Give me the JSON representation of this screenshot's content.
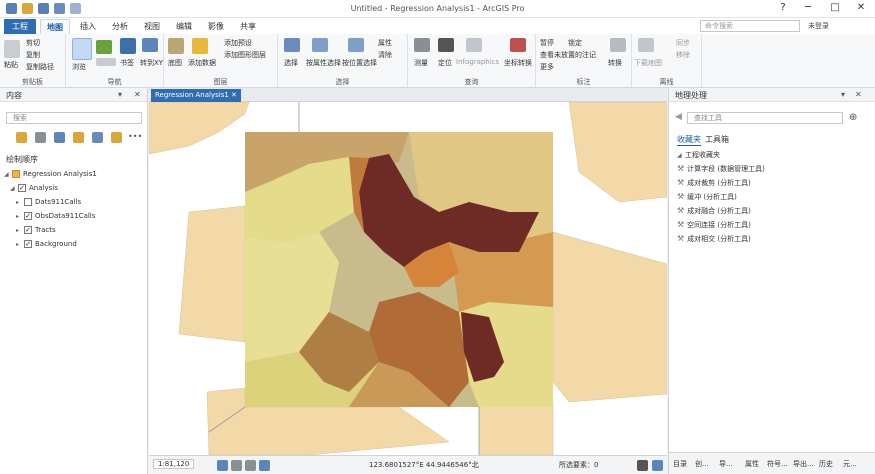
{
  "window": {
    "title": "Untitled - Regression Analysis1 - ArcGIS Pro",
    "minimize": "─",
    "maximize": "□",
    "close": "✕",
    "help": "?",
    "user": "未登录"
  },
  "tabs": [
    {
      "label": "工程"
    },
    {
      "label": "地图"
    },
    {
      "label": "插入"
    },
    {
      "label": "分析"
    },
    {
      "label": "视图"
    },
    {
      "label": "编辑"
    },
    {
      "label": "影像"
    },
    {
      "label": "共享"
    }
  ],
  "search": {
    "placeholder": "命令搜索"
  },
  "ribbon": {
    "clipboard": {
      "label": "剪贴板",
      "paste": "粘贴",
      "cut": "剪切",
      "copy": "复制",
      "copy_path": "复制路径"
    },
    "navigate": {
      "label": "导航",
      "explore": "浏览",
      "bookmarks": "书签",
      "go_to_xy": "转到XY"
    },
    "layer": {
      "label": "图层",
      "basemap": "底图",
      "add_data": "添加数据",
      "add_preset": "添加预设",
      "add_graphics": "添加图形图层"
    },
    "selection": {
      "label": "选择",
      "select": "选择",
      "select_by_attr": "按属性选择",
      "select_by_loc": "按位置选择",
      "attributes": "属性",
      "clear": "清除"
    },
    "inquiry": {
      "label": "查询",
      "measure": "测量",
      "locate": "定位",
      "infographics": "Infographics",
      "coordinate_conversion": "坐标转换"
    },
    "labeling": {
      "label": "标注",
      "pause": "暂停",
      "view_unplaced": "查看未放置的注记",
      "lock": "锁定",
      "more": "更多",
      "convert": "转换"
    },
    "offline": {
      "label": "离线",
      "download_map": "下载地图",
      "sync": "同步",
      "remove": "移除"
    }
  },
  "contents": {
    "title": "内容",
    "pin": "▾",
    "close": "✕",
    "search_placeholder": "搜索",
    "drawing_order": "绘制顺序",
    "items": [
      {
        "label": "Regression Analysis1",
        "level": 0,
        "checked": false
      },
      {
        "label": "Analysis",
        "level": 1,
        "checked": true
      },
      {
        "label": "Dats911Calls",
        "level": 2,
        "checked": false
      },
      {
        "label": "ObsData911Calls",
        "level": 2,
        "checked": true
      },
      {
        "label": "Tracts",
        "level": 2,
        "checked": true
      },
      {
        "label": "Background",
        "level": 2,
        "checked": true
      }
    ]
  },
  "map_tab": {
    "label": "Regression Analysis1",
    "close": "✕"
  },
  "statusbar": {
    "scale": "1:81,120",
    "coords": "123.6801527°E 44.9446546°北",
    "selected": "所选要素：0"
  },
  "geoprocessing": {
    "title": "地理处理",
    "search_placeholder": "查找工具",
    "tabs": [
      "收藏夹",
      "工具箱"
    ],
    "section": "工程收藏夹",
    "tools": [
      "计算字段 (数据管理工具)",
      "成对裁剪 (分析工具)",
      "缓冲 (分析工具)",
      "成对融合 (分析工具)",
      "空间连接 (分析工具)",
      "成对相交 (分析工具)"
    ]
  },
  "right_bottom": [
    "目录",
    "创...",
    "导...",
    "属性",
    "符号...",
    "导出...",
    "历史",
    "元..."
  ],
  "colors": {
    "accent": "#2e6db4",
    "choropleth_dark": "#6e2a24",
    "choropleth_mid": "#b06b36",
    "choropleth_light": "#e4dc8a",
    "background_tan": "#f4d9a8"
  }
}
